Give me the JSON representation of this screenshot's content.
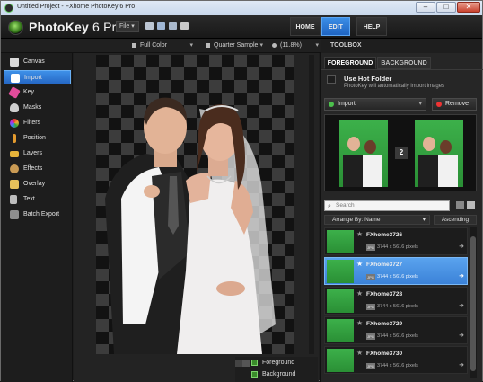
{
  "window": {
    "title": "Untitled Project - FXhome PhotoKey 6 Pro",
    "minimize": "–",
    "maximize": "□",
    "close": "✕"
  },
  "app": {
    "brand": "PhotoKey",
    "version": "6 Pro",
    "file_menu": "File ▾"
  },
  "nav": {
    "home": "HOME",
    "edit": "EDIT",
    "help": "HELP"
  },
  "options": {
    "color": "Full Color",
    "sample": "Quarter Sample",
    "zoom": "(11.8%)"
  },
  "toolbox": {
    "title": "TOOLBOX"
  },
  "sidebar": {
    "items": [
      {
        "label": "Canvas",
        "color": "#d9d9d9"
      },
      {
        "label": "Import",
        "color": "#ffffff"
      },
      {
        "label": "Key",
        "color": "#e24c9b"
      },
      {
        "label": "Masks",
        "color": "#cfcfcf"
      },
      {
        "label": "Filters",
        "color": "#e99a2b"
      },
      {
        "label": "Position",
        "color": "#e39a2e"
      },
      {
        "label": "Layers",
        "color": "#e7b43a"
      },
      {
        "label": "Effects",
        "color": "#c99a54"
      },
      {
        "label": "Overlay",
        "color": "#e8c25b"
      },
      {
        "label": "Text",
        "color": "#bdbdbd"
      },
      {
        "label": "Batch Export",
        "color": "#8e8e8e"
      }
    ],
    "active": "Import"
  },
  "canvas": {
    "layers": [
      {
        "label": "Foreground",
        "checked": true
      },
      {
        "label": "Background",
        "checked": true
      }
    ]
  },
  "panel": {
    "tabs": [
      "FOREGROUND",
      "BACKGROUND"
    ],
    "hot_folder": {
      "title": "Use Hot Folder",
      "subtitle": "PhotoKey will automatically import images"
    },
    "import_button": "Import",
    "remove_button": "Remove",
    "preview_count": "2",
    "search_placeholder": "Search",
    "arrange": "Arrange By: Name",
    "order": "Ascending",
    "files": [
      {
        "name": "FXhome3726",
        "info": "3744 x 5616 pixels",
        "selected": false
      },
      {
        "name": "FXhome3727",
        "info": "3744 x 5616 pixels",
        "selected": true
      },
      {
        "name": "FXhome3728",
        "info": "3744 x 5616 pixels",
        "selected": false
      },
      {
        "name": "FXhome3729",
        "info": "3744 x 5616 pixels",
        "selected": false
      },
      {
        "name": "FXhome3730",
        "info": "3744 x 5616 pixels",
        "selected": false
      }
    ],
    "file_type": "JPG"
  }
}
